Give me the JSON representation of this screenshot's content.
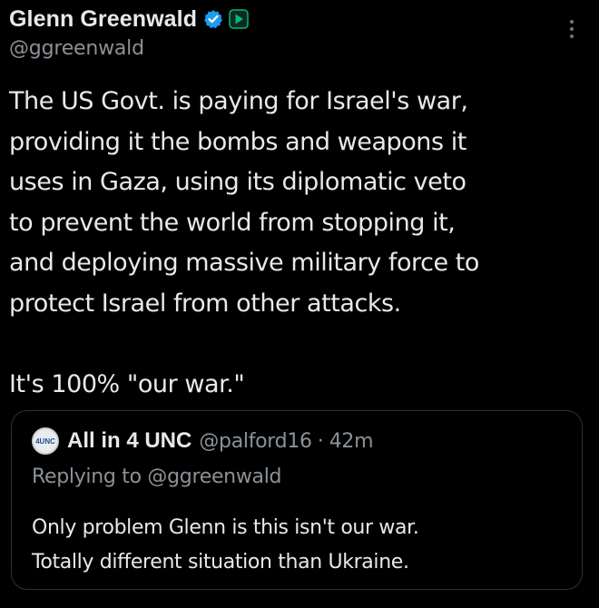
{
  "author": {
    "display_name": "Glenn Greenwald",
    "handle": "@ggreenwald",
    "verified_icon": "verified-badge-icon",
    "affiliate_icon": "affiliate-badge-icon"
  },
  "more_icon": "more-options-icon",
  "tweet": {
    "text": "The US Govt. is paying for Israel's war,\nproviding it the bombs and weapons it\nuses in Gaza, using its diplomatic veto\nto prevent the world from stopping it,\nand deploying massive military force to\nprotect Israel from other attacks.\n\nIt's 100% \"our war.\""
  },
  "quote": {
    "avatar_text": "4UNC",
    "display_name": "All in 4 UNC",
    "handle": "@palford16",
    "separator": "·",
    "time": "42m",
    "replying_to": "Replying to @ggreenwald",
    "text": "Only problem Glenn is this isn't our war.\nTotally different situation than Ukraine."
  },
  "colors": {
    "background": "#000000",
    "text": "#e7e9ea",
    "secondary_text": "#8b9197",
    "verified_blue": "#1d9bf0",
    "affiliate_green": "#00ba7c",
    "border": "#2f3336"
  }
}
